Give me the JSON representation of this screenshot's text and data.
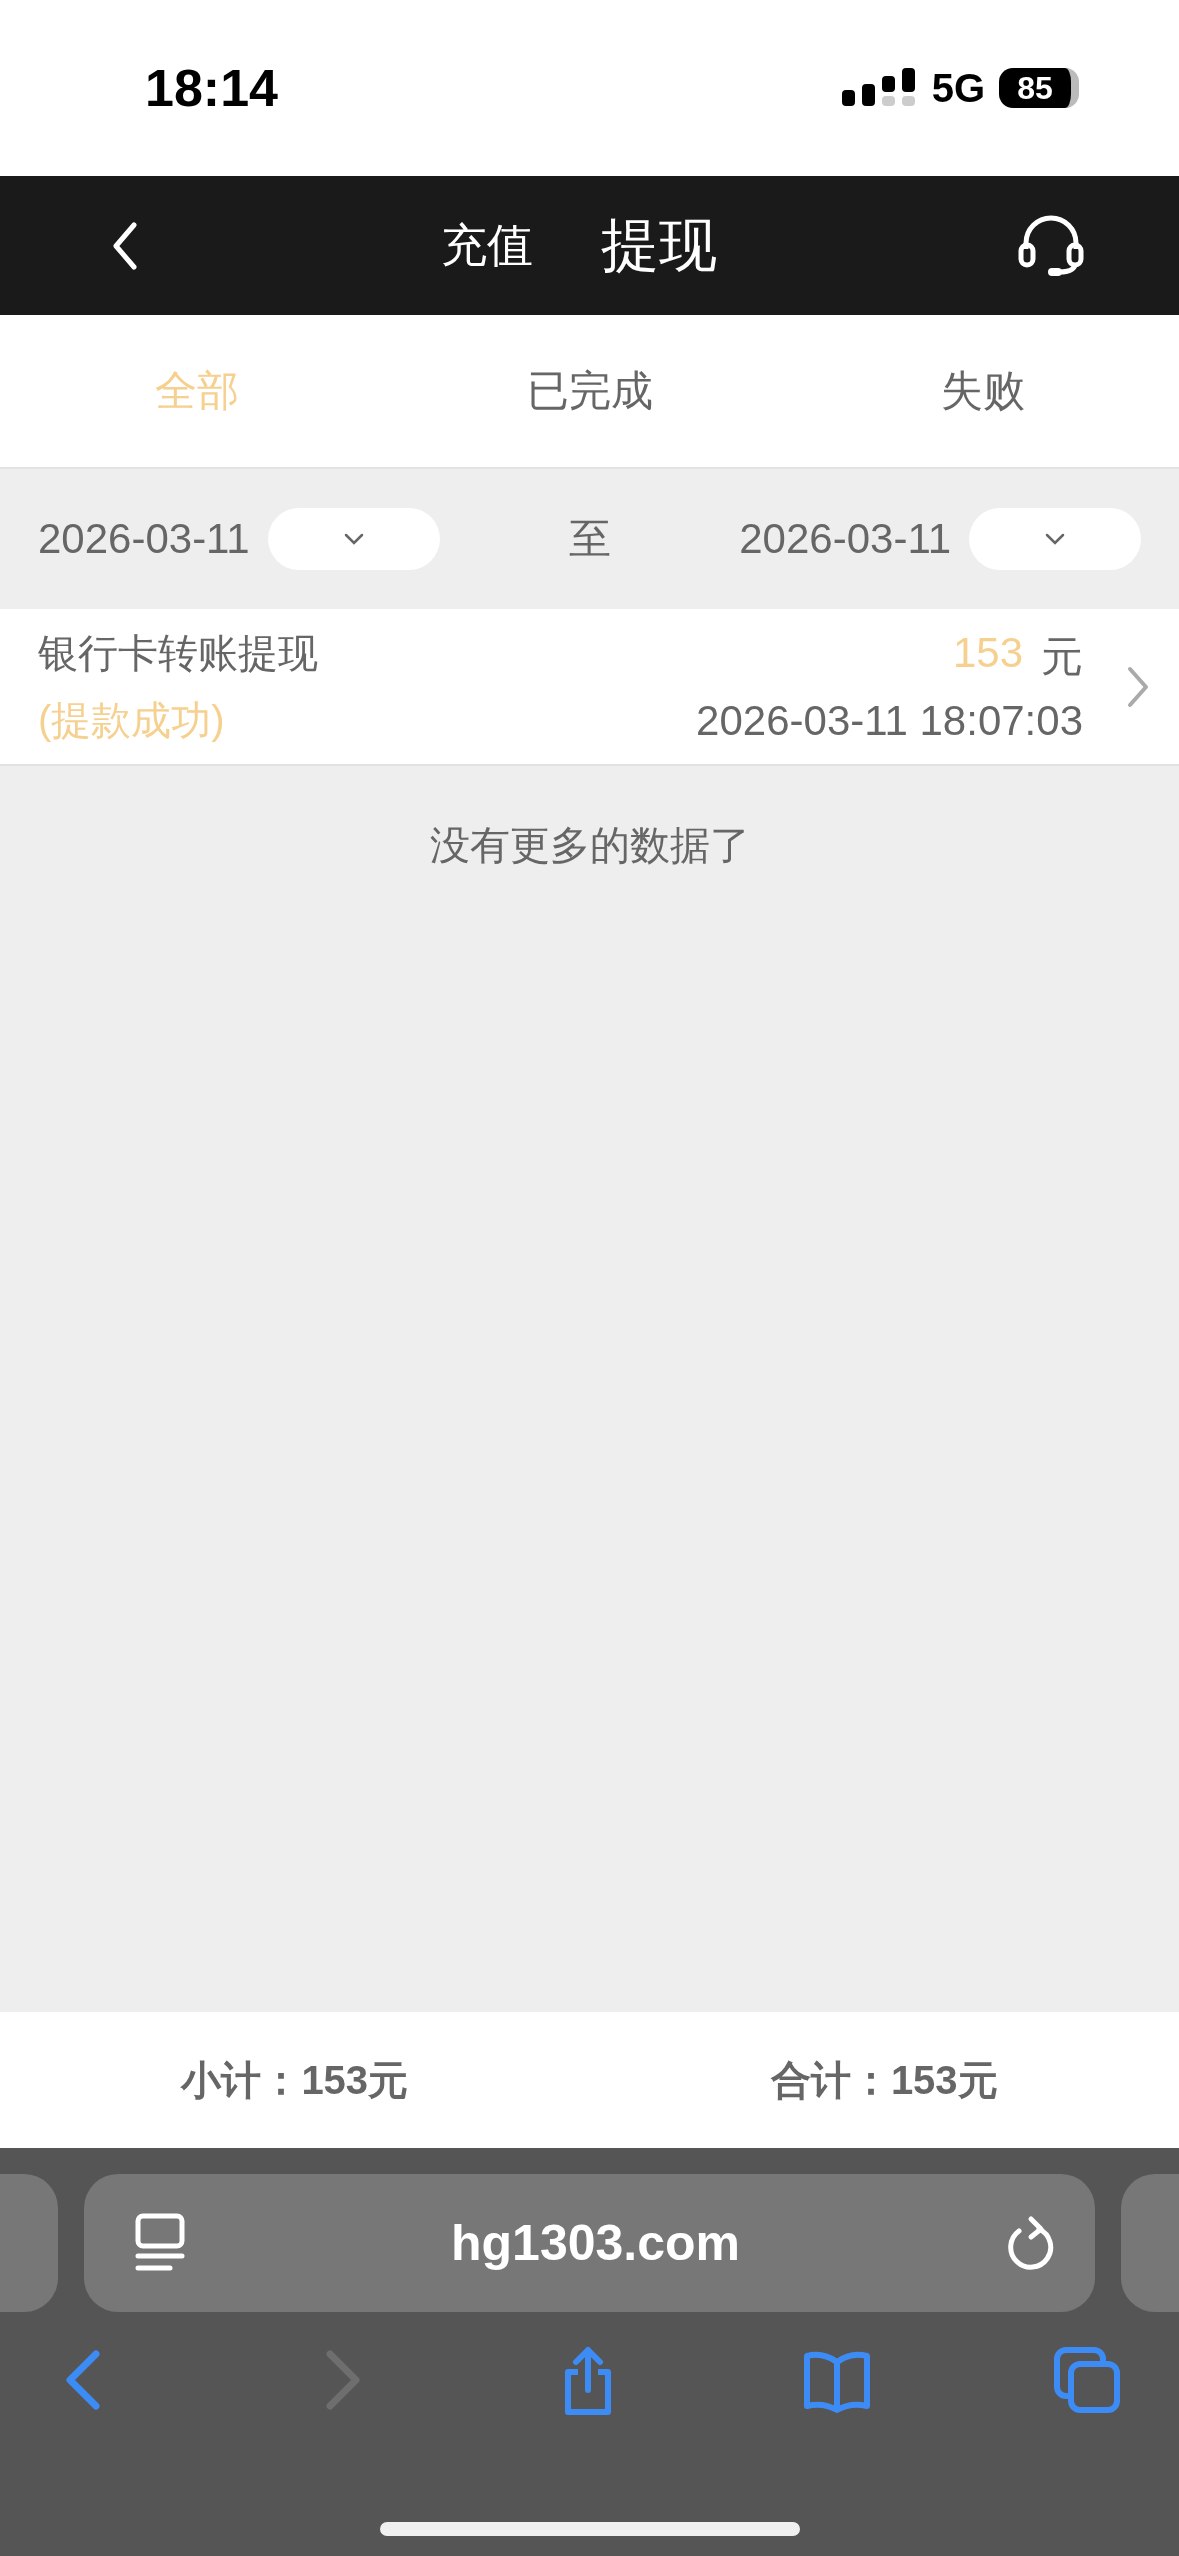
{
  "status_bar": {
    "time": "18:14",
    "network": "5G",
    "battery": "85"
  },
  "nav": {
    "segments": [
      {
        "label": "充值",
        "selected": false
      },
      {
        "label": "提现",
        "selected": true
      }
    ]
  },
  "tabs": [
    {
      "label": "全部",
      "selected": true
    },
    {
      "label": "已完成",
      "selected": false
    },
    {
      "label": "失败",
      "selected": false
    }
  ],
  "date_filter": {
    "start": "2026-03-11",
    "separator": "至",
    "end": "2026-03-11"
  },
  "records": [
    {
      "title": "银行卡转账提现",
      "status": "(提款成功)",
      "amount": "153",
      "currency": "元",
      "time": "2026-03-11 18:07:03"
    }
  ],
  "end_note": "没有更多的数据了",
  "footer": {
    "subtotal": "小计：153元",
    "total": "合计：153元"
  },
  "browser": {
    "url": "hg1303.com",
    "toolbar": [
      {
        "kind": "back",
        "disabled": false
      },
      {
        "kind": "forward",
        "disabled": true
      },
      {
        "kind": "share",
        "disabled": false
      },
      {
        "kind": "bookmarks",
        "disabled": false
      },
      {
        "kind": "tabs",
        "disabled": false
      }
    ]
  }
}
